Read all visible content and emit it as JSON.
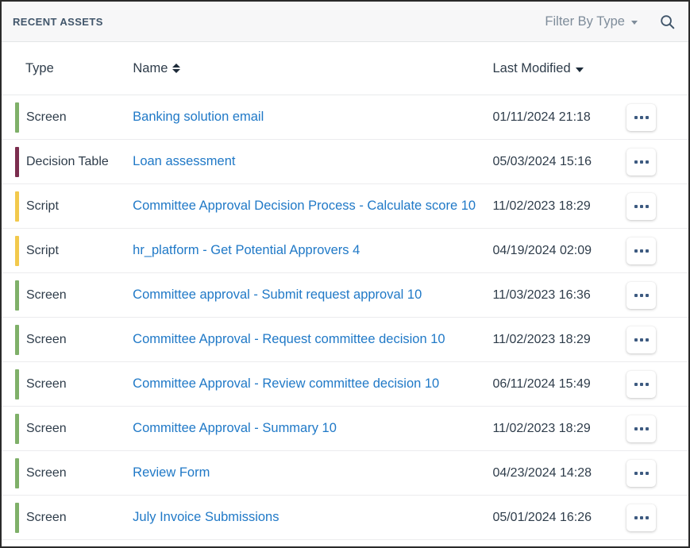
{
  "header": {
    "title": "RECENT ASSETS",
    "filter_label": "Filter By Type",
    "filter_icon": "chevron-down-icon",
    "search_icon": "search-icon"
  },
  "table": {
    "columns": {
      "type": "Type",
      "name": "Name",
      "last_modified": "Last Modified",
      "actions": ""
    },
    "sort": {
      "name_state": "sortable-both",
      "last_modified_state": "descending"
    },
    "row_action_icon": "ellipsis-icon",
    "type_colors": {
      "Screen": "#7fb069",
      "Decision Table": "#7b2d4e",
      "Script": "#f2c94c"
    },
    "rows": [
      {
        "type": "Screen",
        "name": "Banking solution email",
        "last_modified": "01/11/2024 21:18",
        "color": "#7fb069"
      },
      {
        "type": "Decision Table",
        "name": "Loan assessment",
        "last_modified": "05/03/2024 15:16",
        "color": "#7b2d4e"
      },
      {
        "type": "Script",
        "name": "Committee Approval Decision Process - Calculate score 10",
        "last_modified": "11/02/2023 18:29",
        "color": "#f2c94c"
      },
      {
        "type": "Script",
        "name": "hr_platform - Get Potential Approvers 4",
        "last_modified": "04/19/2024 02:09",
        "color": "#f2c94c"
      },
      {
        "type": "Screen",
        "name": "Committee approval - Submit request approval 10",
        "last_modified": "11/03/2023 16:36",
        "color": "#7fb069"
      },
      {
        "type": "Screen",
        "name": "Committee Approval - Request committee decision 10",
        "last_modified": "11/02/2023 18:29",
        "color": "#7fb069"
      },
      {
        "type": "Screen",
        "name": "Committee Approval - Review committee decision 10",
        "last_modified": "06/11/2024 15:49",
        "color": "#7fb069"
      },
      {
        "type": "Screen",
        "name": "Committee Approval - Summary 10",
        "last_modified": "11/02/2023 18:29",
        "color": "#7fb069"
      },
      {
        "type": "Screen",
        "name": "Review Form",
        "last_modified": "04/23/2024 14:28",
        "color": "#7fb069"
      },
      {
        "type": "Screen",
        "name": "July Invoice Submissions",
        "last_modified": "05/01/2024 16:26",
        "color": "#7fb069"
      }
    ]
  }
}
